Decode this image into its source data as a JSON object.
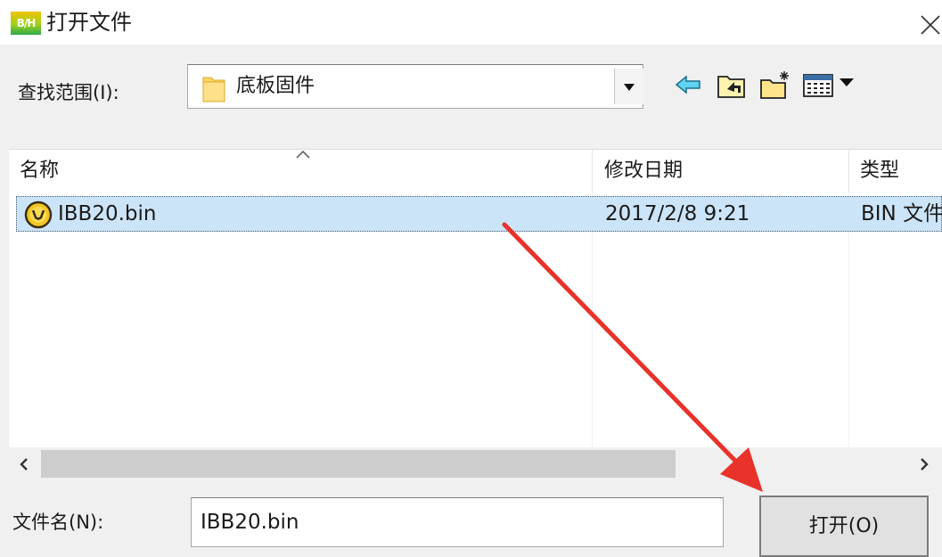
{
  "window": {
    "title": "打开文件",
    "app_icon_text": "B/H"
  },
  "lookin": {
    "label": "查找范围(I):",
    "value": "底板固件"
  },
  "toolbar": {
    "icons": [
      "back-arrow-icon",
      "up-folder-icon",
      "new-folder-icon",
      "view-menu-icon"
    ]
  },
  "list": {
    "columns": [
      "名称",
      "修改日期",
      "类型"
    ],
    "rows": [
      {
        "name": "IBB20.bin",
        "modified": "2017/2/8 9:21",
        "type": "BIN 文件"
      }
    ]
  },
  "filename": {
    "label": "文件名(N):",
    "value": "IBB20.bin"
  },
  "buttons": {
    "open": "打开(O)"
  },
  "colors": {
    "selection": "#cce4f7",
    "annotation_arrow": "#e8322a",
    "accent": "#1e90ff"
  }
}
